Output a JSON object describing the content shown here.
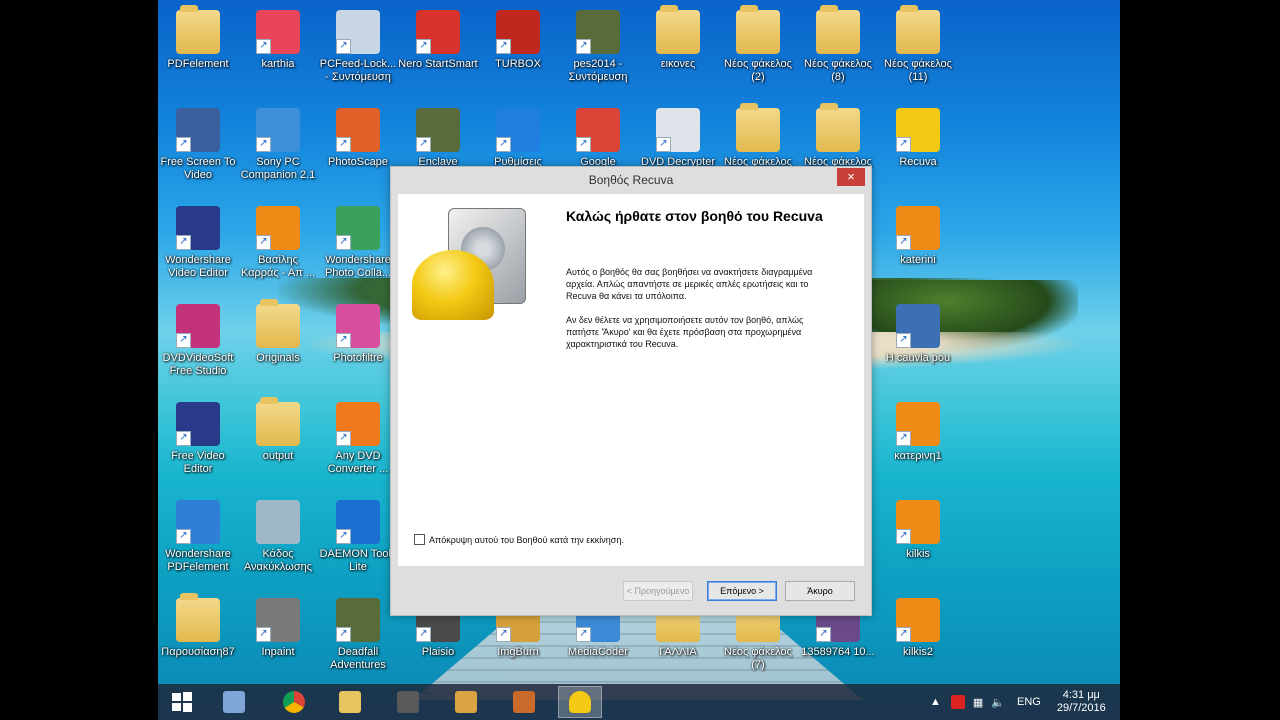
{
  "desktop": {
    "icons": [
      {
        "label": "PDFelement",
        "icon": "folder-icon"
      },
      {
        "label": "karthia",
        "icon": "heart-icon"
      },
      {
        "label": "PCFeed-Lock... - Συντόμευση",
        "icon": "shortcut-app-icon"
      },
      {
        "label": "Nero StartSmart",
        "icon": "nero-icon"
      },
      {
        "label": "TURBOX",
        "icon": "flash-icon"
      },
      {
        "label": "pes2014 - Συντόμευση",
        "icon": "game-icon"
      },
      {
        "label": "εικονες",
        "icon": "folder-icon"
      },
      {
        "label": "Νέος φάκελος (2)",
        "icon": "folder-icon"
      },
      {
        "label": "Νέος φάκελος (8)",
        "icon": "folder-icon"
      },
      {
        "label": "Νέος φάκελος (11)",
        "icon": "folder-icon"
      },
      {
        "label": "Free Screen To Video",
        "icon": "screen-recorder-icon"
      },
      {
        "label": "Sony PC Companion 2.1",
        "icon": "sony-icon"
      },
      {
        "label": "PhotoScape",
        "icon": "photoscape-icon"
      },
      {
        "label": "Enclave",
        "icon": "game-icon"
      },
      {
        "label": "Ρυθμίσεις",
        "icon": "gear-icon"
      },
      {
        "label": "Google",
        "icon": "chrome-icon"
      },
      {
        "label": "DVD Decrypter",
        "icon": "dvd-icon"
      },
      {
        "label": "Νέος φάκελος",
        "icon": "folder-icon"
      },
      {
        "label": "Νέος φάκελος",
        "icon": "folder-icon"
      },
      {
        "label": "Recuva",
        "icon": "recuva-icon"
      },
      {
        "label": "Wondershare Video Editor",
        "icon": "video-editor-icon"
      },
      {
        "label": "Βασίλης Καρράς - Απ ...",
        "icon": "vlc-icon"
      },
      {
        "label": "Wondershare Photo Colla...",
        "icon": "photo-collage-icon"
      },
      {
        "label": "katerini",
        "icon": "vlc-icon"
      },
      {
        "label": "DVDVideoSoft Free Studio",
        "icon": "fs-icon"
      },
      {
        "label": "Originals",
        "icon": "folder-icon"
      },
      {
        "label": "Photofiltre",
        "icon": "photofiltre-icon"
      },
      {
        "label": "H cauvla pou",
        "icon": "media-icon"
      },
      {
        "label": "Free Video Editor",
        "icon": "video-editor-icon"
      },
      {
        "label": "output",
        "icon": "folder-icon"
      },
      {
        "label": "Any DVD Converter ...",
        "icon": "dvd-converter-icon"
      },
      {
        "label": "κατερινη1",
        "icon": "vlc-icon"
      },
      {
        "label": "Wondershare PDFelement",
        "icon": "pdf-icon"
      },
      {
        "label": "Κάδος Ανακύκλωσης",
        "icon": "recycle-bin-icon"
      },
      {
        "label": "DAEMON Tools Lite",
        "icon": "daemon-icon"
      },
      {
        "label": "kilkis",
        "icon": "vlc-icon"
      },
      {
        "label": "Παρουσίαση87",
        "icon": "folder-icon"
      },
      {
        "label": "Inpaint",
        "icon": "inpaint-icon"
      },
      {
        "label": "Deadfall Adventures",
        "icon": "game-icon"
      },
      {
        "label": "Plaisio",
        "icon": "app-icon"
      },
      {
        "label": "ImgBurn",
        "icon": "imgburn-icon"
      },
      {
        "label": "MediaCoder",
        "icon": "mediacoder-icon"
      },
      {
        "label": "ΓΑΛΛΙΑ",
        "icon": "folder-icon"
      },
      {
        "label": "Νέος φάκελος (7)",
        "icon": "folder-icon"
      },
      {
        "label": "13589764 10...",
        "icon": "image-icon"
      },
      {
        "label": "kilkis2",
        "icon": "vlc-icon"
      }
    ]
  },
  "dialog": {
    "title": "Βοηθός Recuva",
    "close": "×",
    "heading": "Καλώς ήρθατε στον βοηθό του Recuva",
    "para1": "Αυτός ο βοηθός θα σας βοηθήσει να ανακτήσετε διαγραμμένα αρχεία. Απλώς απαντήστε σε μερικές απλές ερωτήσεις και το Recuva θα κάνει τα υπόλοιπα.",
    "para2": "Αν δεν θέλετε να χρησιμοποιήσετε αυτόν τον βοηθό, απλώς πατήστε 'Άκυρο' και θα έχετε πρόσβαση στα προχωρημένα χαρακτηριστικά του Recuva.",
    "checkbox_label": "Απόκρυψη αυτού του Βοηθού κατά την εκκίνηση.",
    "back": "< Προηγούμενο",
    "next": "Επόμενο >",
    "cancel": "Άκυρο"
  },
  "taskbar": {
    "tray_lang": "ENG",
    "time": "4:31 μμ",
    "date": "29/7/2016"
  }
}
